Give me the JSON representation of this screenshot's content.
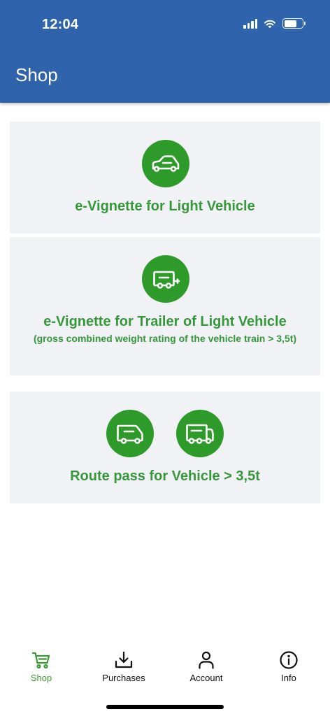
{
  "status_bar": {
    "time": "12:04"
  },
  "header": {
    "title": "Shop"
  },
  "cards": [
    {
      "title": "e-Vignette for Light Vehicle",
      "icons": [
        "car-icon"
      ]
    },
    {
      "title": "e-Vignette for Trailer of Light Vehicle",
      "subtitle": "(gross combined weight rating of the vehicle train > 3,5t)",
      "icons": [
        "trailer-icon"
      ]
    },
    {
      "title": "Route pass for Vehicle > 3,5t",
      "icons": [
        "van-icon",
        "truck-icon"
      ]
    }
  ],
  "tabs": [
    {
      "label": "Shop",
      "icon": "cart-icon",
      "active": true
    },
    {
      "label": "Purchases",
      "icon": "download-tray-icon",
      "active": false
    },
    {
      "label": "Account",
      "icon": "person-icon",
      "active": false
    },
    {
      "label": "Info",
      "icon": "info-icon",
      "active": false
    }
  ],
  "colors": {
    "header": "#2f63ab",
    "accent_green": "#2e9a2a",
    "card_background": "#f1f2f6"
  }
}
